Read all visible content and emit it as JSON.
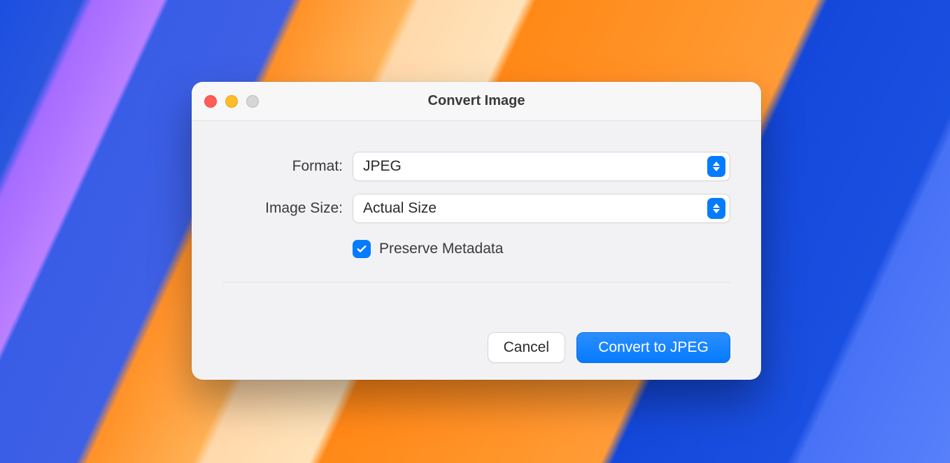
{
  "window": {
    "title": "Convert Image"
  },
  "form": {
    "format_label": "Format:",
    "format_value": "JPEG",
    "size_label": "Image Size:",
    "size_value": "Actual Size",
    "preserve_metadata_label": "Preserve Metadata",
    "preserve_metadata_checked": true
  },
  "buttons": {
    "cancel": "Cancel",
    "convert": "Convert to JPEG"
  }
}
